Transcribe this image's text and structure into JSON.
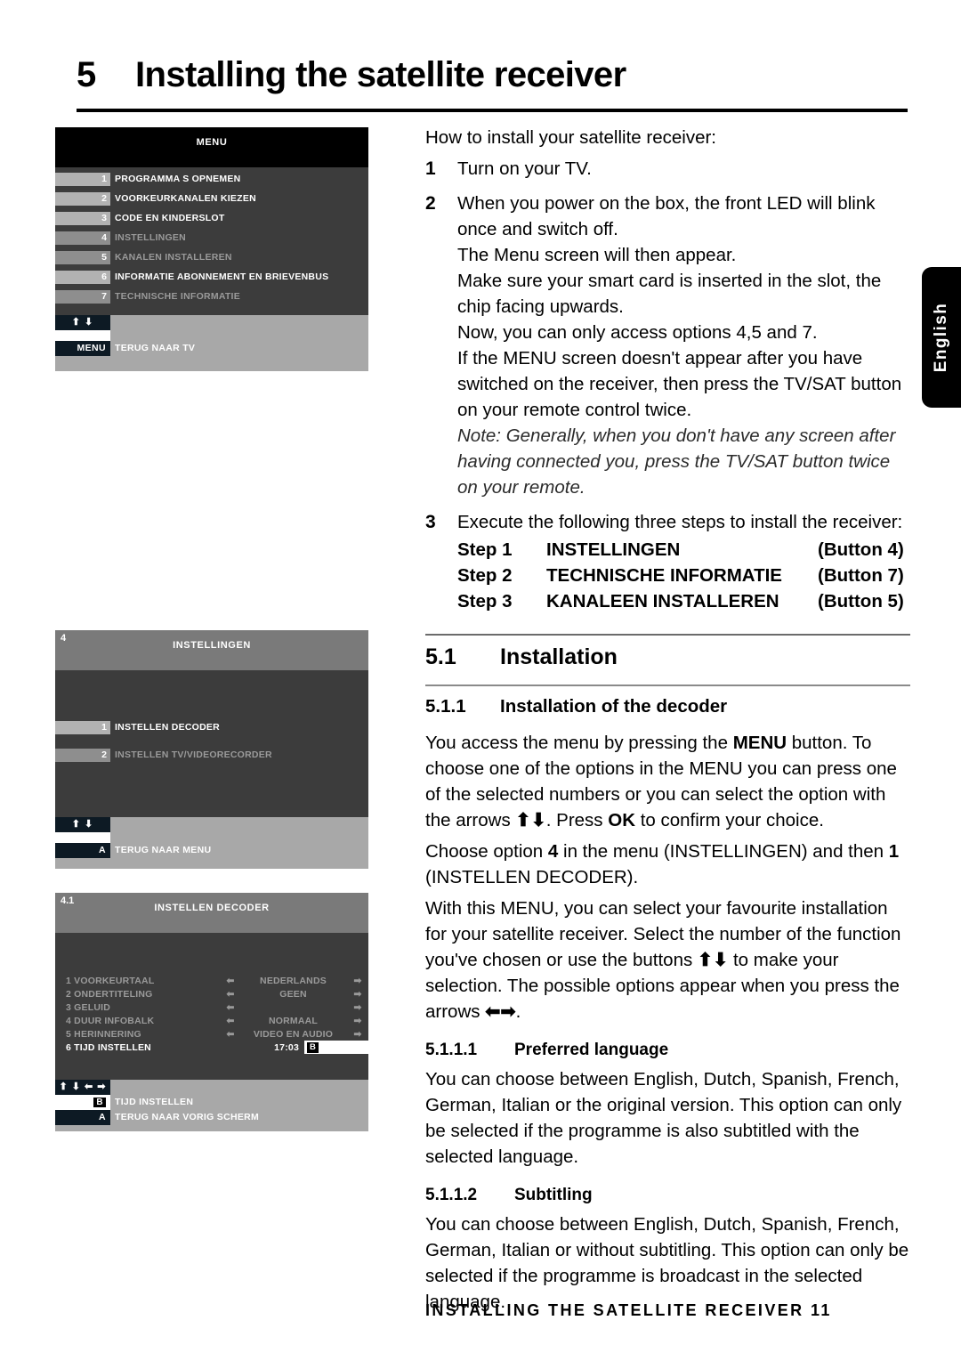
{
  "header": {
    "chapter_number": "5",
    "chapter_title": "Installing the satellite receiver"
  },
  "language_tab": {
    "label": "English"
  },
  "screenshots": [
    {
      "id": "menu-screen",
      "index_label": "",
      "title": "MENU",
      "items": [
        {
          "num": "1",
          "label": "PROGRAMMA S OPNEMEN",
          "dim": false
        },
        {
          "num": "2",
          "label": "VOORKEURKANALEN KIEZEN",
          "dim": false
        },
        {
          "num": "3",
          "label": "CODE EN KINDERSLOT",
          "dim": false
        },
        {
          "num": "4",
          "label": "INSTELLINGEN",
          "dim": true
        },
        {
          "num": "5",
          "label": "KANALEN INSTALLEREN",
          "dim": true
        },
        {
          "num": "6",
          "label": "INFORMATIE ABONNEMENT EN BRIEVENBUS",
          "dim": false
        },
        {
          "num": "7",
          "label": "TECHNISCHE INFORMATIE",
          "dim": true
        }
      ],
      "nav_arrows": "⬆ ⬇",
      "footer_rows": [
        {
          "key": "MENU",
          "label": "TERUG NAAR TV"
        }
      ]
    },
    {
      "id": "instellingen-screen",
      "index_label": "4",
      "title": "INSTELLINGEN",
      "items": [
        {
          "num": "1",
          "label": "INSTELLEN DECODER",
          "dim": false
        },
        {
          "num": "2",
          "label": "INSTELLEN TV/VIDEORECORDER",
          "dim": true
        }
      ],
      "nav_arrows": "⬆ ⬇",
      "footer_rows": [
        {
          "key": "A",
          "label": "TERUG NAAR MENU"
        }
      ]
    },
    {
      "id": "instellen-decoder-screen",
      "index_label": "4.1",
      "title": "INSTELLEN DECODER",
      "settings": [
        {
          "num": "1",
          "name": "VOORKEURTAAL",
          "value": "NEDERLANDS",
          "active": false
        },
        {
          "num": "2",
          "name": "ONDERTITELING",
          "value": "GEEN",
          "active": false
        },
        {
          "num": "3",
          "name": "GELUID",
          "value": "",
          "active": false
        },
        {
          "num": "4",
          "name": "DUUR INFOBALK",
          "value": "NORMAAL",
          "active": false
        },
        {
          "num": "5",
          "name": "HERINNERING",
          "value": "VIDEO EN AUDIO",
          "active": false
        },
        {
          "num": "6",
          "name": "TIJD INSTELLEN",
          "value": "17:03",
          "active": true,
          "key_box": "B"
        }
      ],
      "nav_arrows": "⬆ ⬇ ⬅ ➡",
      "footer_rows": [
        {
          "key": "B",
          "label": "TIJD INSTELLEN",
          "white": true
        },
        {
          "key": "A",
          "label": "TERUG NAAR VORIG SCHERM"
        }
      ]
    }
  ],
  "body": {
    "intro": "How to install your satellite receiver:",
    "items": [
      {
        "n": "1",
        "lines": [
          "Turn on your TV."
        ]
      },
      {
        "n": "2",
        "lines": [
          "When you power on the box, the front LED will blink once and switch off.",
          "The Menu screen will then appear.",
          "Make sure your smart card is inserted in the slot, the chip facing upwards.",
          "Now, you can only access options 4,5 and 7.",
          "If the MENU screen doesn't appear after you have switched on the receiver, then press the TV/SAT button on your remote control twice."
        ],
        "note": "Note: Generally, when you don't have any screen after having connected you, press the TV/SAT button twice on your remote."
      },
      {
        "n": "3",
        "lines": [
          "Execute the following three steps to install the receiver:"
        ]
      }
    ],
    "steps": [
      {
        "step": "Step 1",
        "name": "INSTELLINGEN",
        "button": "(Button 4)"
      },
      {
        "step": "Step 2",
        "name": "TECHNISCHE INFORMATIE",
        "button": "(Button 7)"
      },
      {
        "step": "Step 3",
        "name": "KANALEEN INSTALLEREN",
        "button": "(Button 5)"
      }
    ],
    "section": {
      "number": "5.1",
      "title": "Installation"
    },
    "subsection": {
      "number": "5.1.1",
      "title": "Installation of the decoder"
    },
    "p1_a": "You access the menu by pressing the ",
    "p1_menu": "MENU",
    "p1_b": " button. To choose one of the options in the MENU you can press one of the selected numbers or you can select the option with the arrows ",
    "p1_arrows": "⬆⬇",
    "p1_c": ". Press ",
    "p1_ok": "OK",
    "p1_d": " to confirm your choice.",
    "p2_a": "Choose option ",
    "p2_four": "4",
    "p2_b": " in the menu (INSTELLINGEN) and then ",
    "p2_one": "1",
    "p2_c": " (INSTELLEN DECODER).",
    "p3_a": "With this MENU, you can select your favourite installation for your satellite receiver.  Select the number of the function you've chosen or use the buttons ",
    "p3_arrows": "⬆⬇",
    "p3_b": " to make your selection. The possible options appear when you press the arrows ",
    "p3_arrows2": "⬅➡",
    "p3_c": ".",
    "subsub1": {
      "number": "5.1.1.1",
      "title": "Preferred language"
    },
    "p4": "You can choose between English, Dutch, Spanish, French, German, Italian or the original version. This option can only be selected if the programme is also subtitled with the selected language.",
    "subsub2": {
      "number": "5.1.1.2",
      "title": "Subtitling"
    },
    "p5": "You can choose between English, Dutch, Spanish, French, German, Italian or without subtitling. This option can only be selected if the programme is broadcast in the selected language."
  },
  "footer": {
    "text": "INSTALLING THE SATELLITE RECEIVER  11"
  }
}
